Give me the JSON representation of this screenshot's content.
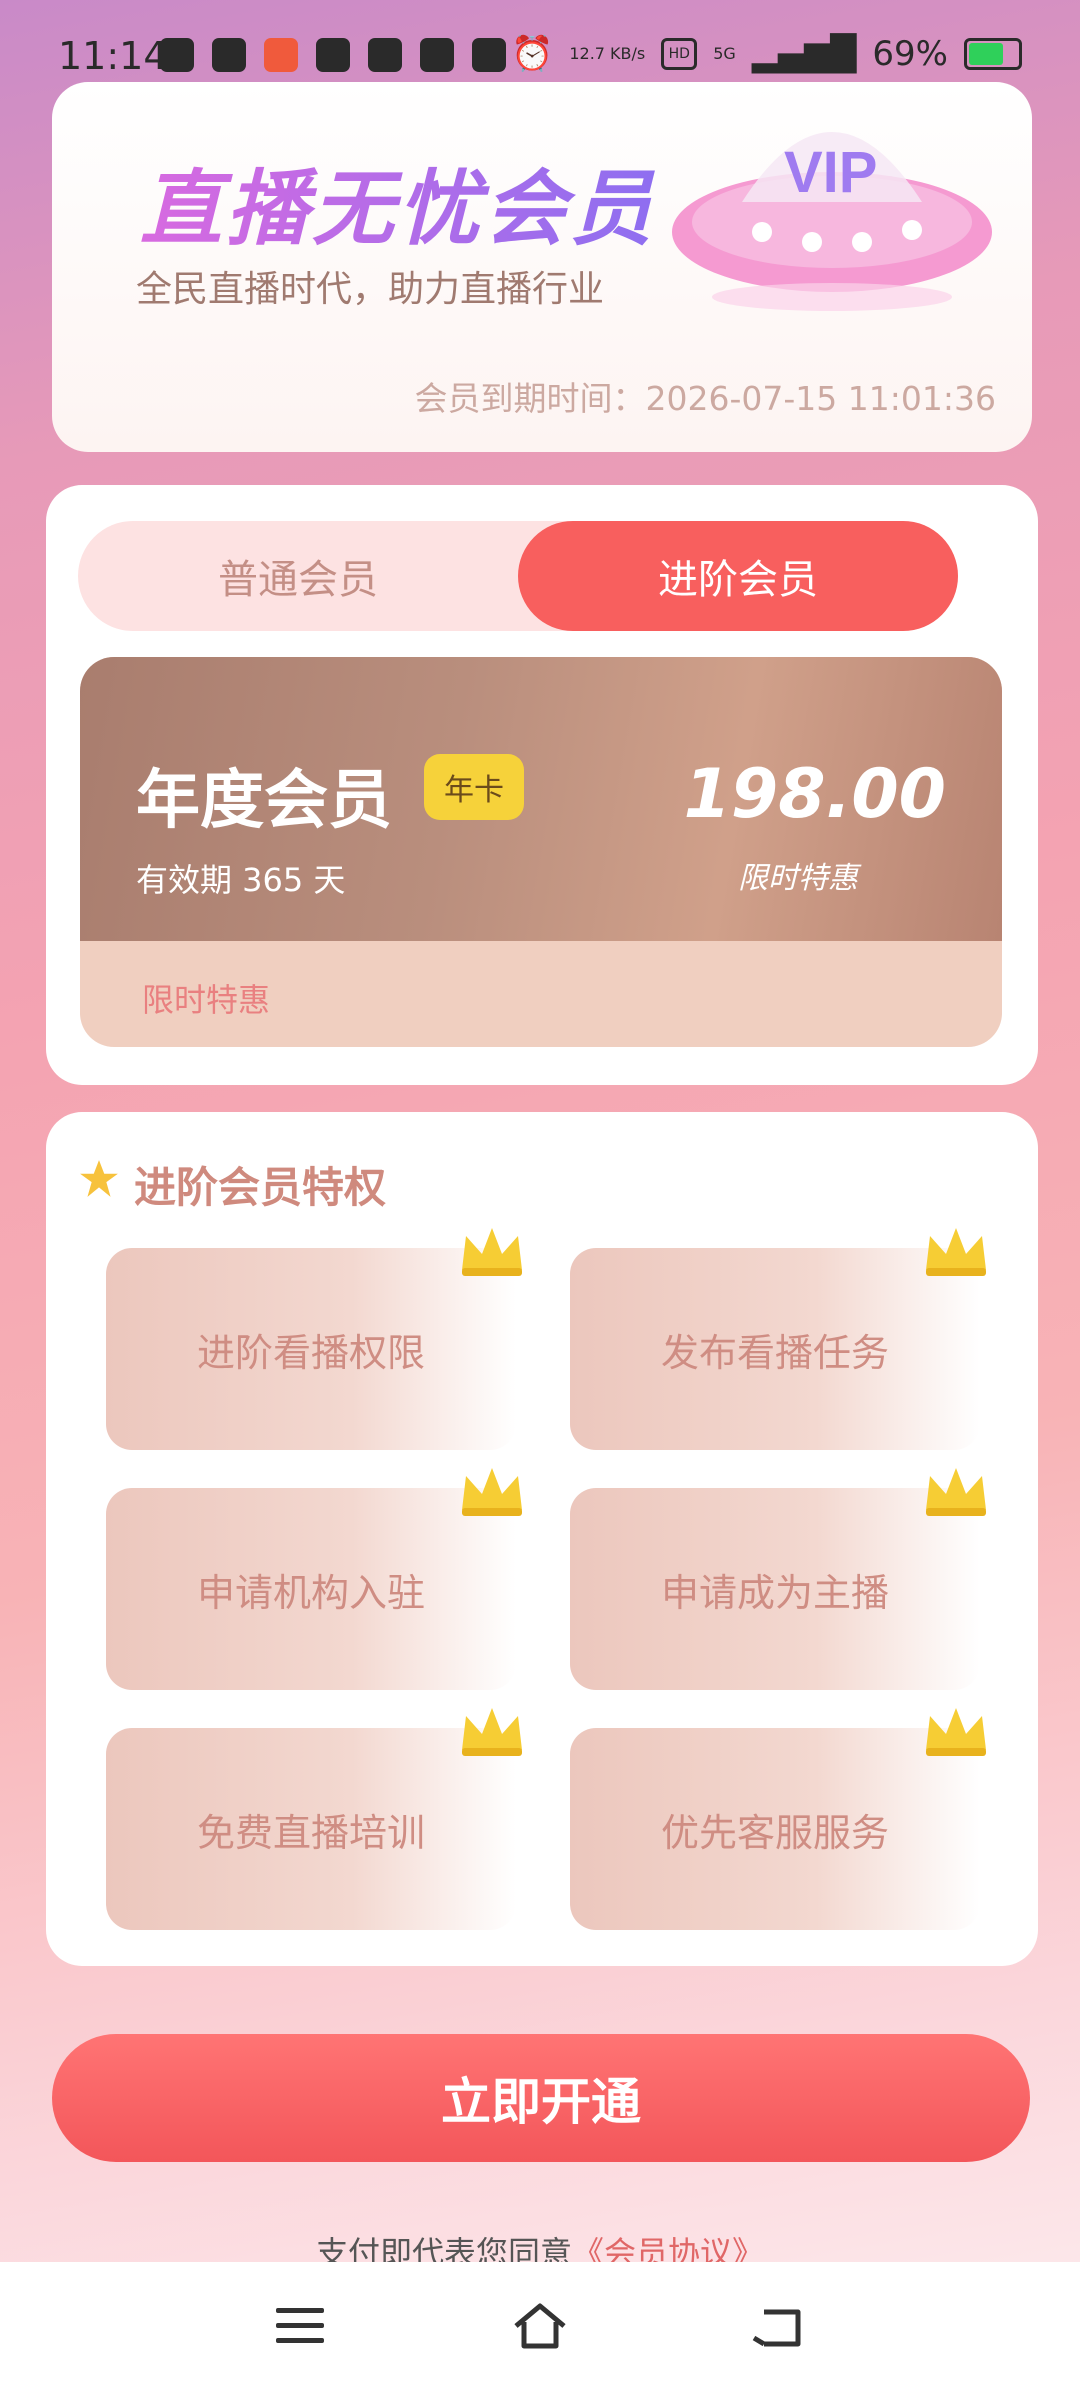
{
  "status_bar": {
    "time": "11:14",
    "net_speed": "12.7 KB/s",
    "signal": "5G",
    "battery": "69%"
  },
  "hero": {
    "title": "直播无忧会员",
    "subtitle": "全民直播时代，助力直播行业",
    "expiry": "会员到期时间：2026-07-15 11:01:36"
  },
  "plan_tabs": {
    "basic_label": "普通会员",
    "advanced_label": "进阶会员",
    "active": "进阶会员"
  },
  "plan_card": {
    "name": "年度会员",
    "badge": "年卡",
    "validity": "有效期 365 天",
    "price": "198.00",
    "promo_label": "限时特惠",
    "footer_label": "限时特惠"
  },
  "benefits": {
    "title": "进阶会员特权",
    "items": [
      "进阶看播权限",
      "发布看播任务",
      "申请机构入驻",
      "申请成为主播",
      "免费直播培训",
      "优先客服服务"
    ]
  },
  "cta": {
    "label": "立即开通"
  },
  "agreement": {
    "prefix": "支付即代表您同意",
    "link": "《会员协议》"
  },
  "colors": {
    "accent": "#f85f5e",
    "gold": "#f6d23a",
    "benefit_text": "#cf8d83"
  },
  "icons": {
    "nav_menu": "menu-icon",
    "nav_home": "home-icon",
    "nav_back": "back-icon",
    "crown": "crown-icon"
  }
}
